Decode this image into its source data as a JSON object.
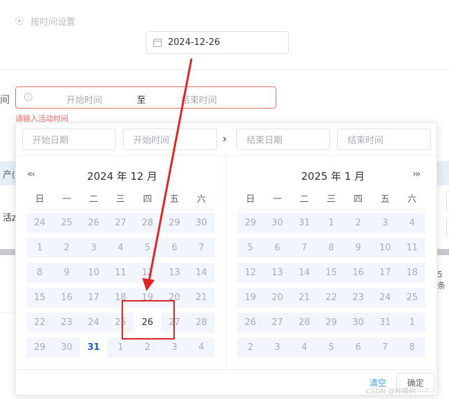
{
  "top": {
    "radio_label": "按时间设置",
    "date_value": "2024-12-26"
  },
  "form": {
    "label_fragment": "间",
    "start_placeholder": "开始时间",
    "separator": "至",
    "end_placeholder": "结束时间",
    "error": "请输入活动时间"
  },
  "background": {
    "table_header_fragment": "产(",
    "table_row_fragment": "活z",
    "pager_fragment": "5条"
  },
  "picker": {
    "start_date_placeholder": "开始日期",
    "start_time_placeholder": "开始时间",
    "end_date_placeholder": "结束日期",
    "end_time_placeholder": "结束时间",
    "range_arrow": "›",
    "prev_nav": "«‹",
    "next_nav": "›»",
    "weekdays": [
      "日",
      "一",
      "二",
      "三",
      "四",
      "五",
      "六"
    ],
    "left_title": "2024 年 12 月",
    "right_title": "2025 年 1 月",
    "left_rows": [
      [
        "24",
        "25",
        "26",
        "27",
        "28",
        "29",
        "30"
      ],
      [
        "1",
        "2",
        "3",
        "4",
        "5",
        "6",
        "7"
      ],
      [
        "8",
        "9",
        "10",
        "11",
        "12",
        "13",
        "14"
      ],
      [
        "15",
        "16",
        "17",
        "18",
        "19",
        "20",
        "21"
      ],
      [
        "22",
        "23",
        "24",
        "25",
        "26",
        "27",
        "28"
      ],
      [
        "29",
        "30",
        "31",
        "1",
        "2",
        "3",
        "4"
      ]
    ],
    "right_rows": [
      [
        "29",
        "30",
        "31",
        "1",
        "2",
        "3",
        "4"
      ],
      [
        "5",
        "6",
        "7",
        "8",
        "9",
        "10",
        "11"
      ],
      [
        "12",
        "13",
        "14",
        "15",
        "16",
        "17",
        "18"
      ],
      [
        "19",
        "20",
        "21",
        "22",
        "23",
        "24",
        "25"
      ],
      [
        "26",
        "27",
        "28",
        "29",
        "30",
        "31",
        "1"
      ],
      [
        "2",
        "3",
        "4",
        "5",
        "6",
        "7",
        "8"
      ]
    ],
    "left_current_cell": [
      4,
      4
    ],
    "left_today_cell": [
      5,
      2
    ],
    "clear_label": "清空",
    "confirm_label": "确定"
  },
  "annotation_color": "#e02525",
  "watermark": "CSDN @柠檬树^-^"
}
